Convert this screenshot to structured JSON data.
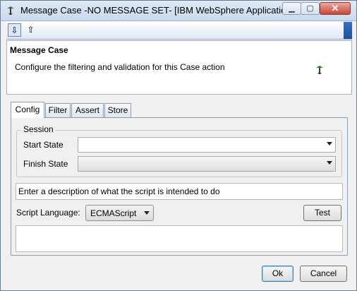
{
  "window": {
    "title": "Message Case -NO MESSAGE SET- [IBM WebSphere Application Se...",
    "minimize_glyph": "▁",
    "maximize_glyph": "▢",
    "close_glyph": "✕"
  },
  "toolbar": {
    "buttons": [
      {
        "icon": "export-icon",
        "glyph": "⇩"
      },
      {
        "icon": "import-icon",
        "glyph": "⇧"
      }
    ]
  },
  "header": {
    "title": "Message Case",
    "description": "Configure the filtering and validation for this Case action"
  },
  "tabs": [
    "Config",
    "Filter",
    "Assert",
    "Store"
  ],
  "active_tab": "Config",
  "session": {
    "legend": "Session",
    "start_state_label": "Start State",
    "start_state_value": "",
    "finish_state_label": "Finish State",
    "finish_state_value": ""
  },
  "script": {
    "description_placeholder": "Enter a description of what the script is intended to do",
    "language_label": "Script Language:",
    "language_value": "ECMAScript",
    "test_label": "Test",
    "body": ""
  },
  "footer": {
    "ok_label": "Ok",
    "cancel_label": "Cancel"
  },
  "colors": {
    "title_gradient_top": "#dfe9f5",
    "toolbar_accent": "#2a5cad",
    "default_button_border": "#3c7fb1"
  }
}
